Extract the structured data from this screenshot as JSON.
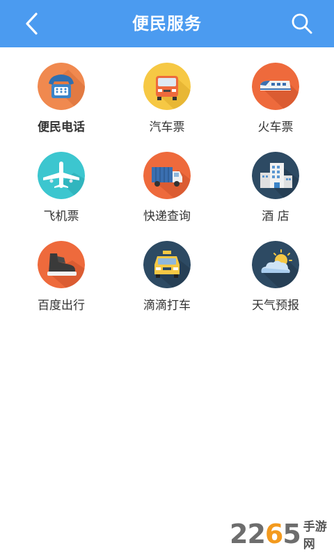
{
  "header": {
    "title": "便民服务",
    "back_icon": "chevron-left-icon",
    "search_icon": "search-icon",
    "bg_color": "#4b9bf0"
  },
  "services": [
    {
      "label": "便民电话",
      "icon": "telephone-icon",
      "color": "#f0894f"
    },
    {
      "label": "汽车票",
      "icon": "bus-icon",
      "color": "#f6c844"
    },
    {
      "label": "火车票",
      "icon": "train-icon",
      "color": "#ee6a3c"
    },
    {
      "label": "飞机票",
      "icon": "airplane-icon",
      "color": "#3cc6cf"
    },
    {
      "label": "快递查询",
      "icon": "delivery-truck-icon",
      "color": "#ee6a3c"
    },
    {
      "label": "酒 店",
      "icon": "hotel-icon",
      "color": "#2d4a63"
    },
    {
      "label": "百度出行",
      "icon": "sneaker-icon",
      "color": "#ee6a3c"
    },
    {
      "label": "滴滴打车",
      "icon": "taxi-icon",
      "color": "#2d4a63"
    },
    {
      "label": "天气预报",
      "icon": "weather-icon",
      "color": "#2d4a63"
    }
  ],
  "watermark": {
    "digits_a": "22",
    "digits_o": "6",
    "digits_b": "5",
    "text": "手游网"
  }
}
